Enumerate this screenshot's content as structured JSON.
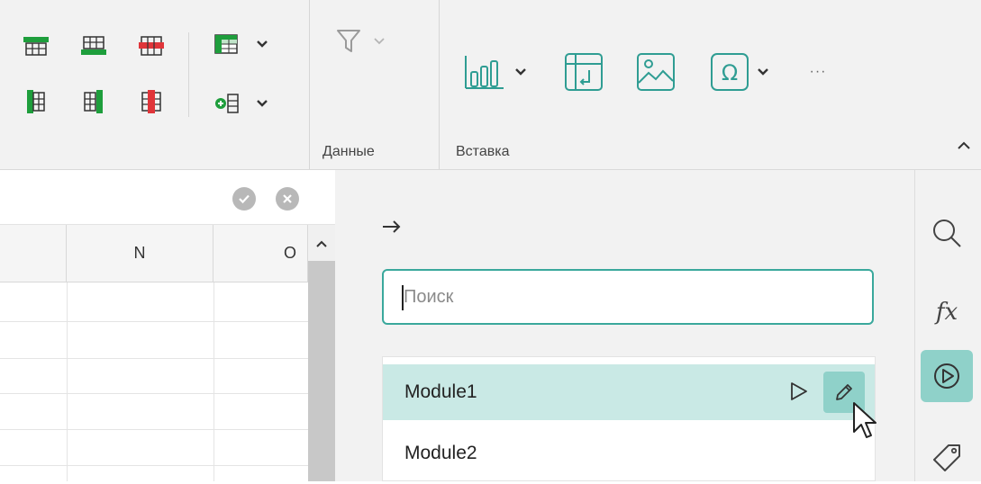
{
  "ribbon": {
    "groups": {
      "data_label": "Данные",
      "insert_label": "Вставка"
    },
    "more_label": "···",
    "accent_green": "#1e9e3c",
    "accent_red": "#e0353a",
    "teal": "#2f9d93"
  },
  "formula_bar": {
    "confirm_icon": "check-icon",
    "cancel_icon": "close-icon"
  },
  "grid": {
    "columns": [
      "N",
      "O"
    ]
  },
  "panel": {
    "search": {
      "placeholder": "Поиск"
    },
    "items": [
      {
        "label": "Module1",
        "selected": true
      },
      {
        "label": "Module2",
        "selected": false
      }
    ]
  },
  "sidebar": {
    "icons": [
      "search-icon",
      "fx-icon",
      "play-circle-icon",
      "tag-icon"
    ],
    "fx_label": "fx"
  }
}
